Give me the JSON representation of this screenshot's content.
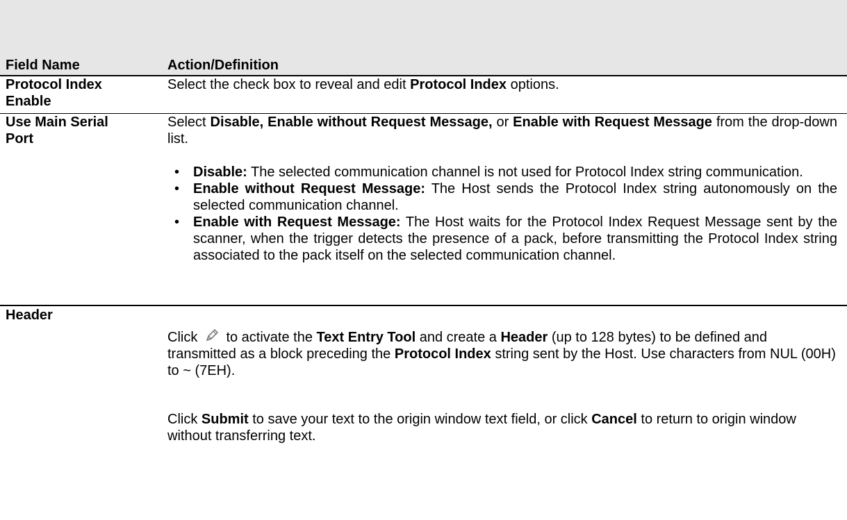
{
  "table": {
    "header": {
      "field": "Field Name",
      "action": "Action/Definition"
    },
    "rows": [
      {
        "field_line1": "Protocol Index",
        "field_line2": "Enable",
        "p1": [
          "Select the check box to reveal and edit ",
          "Protocol Index",
          " options."
        ]
      },
      {
        "field_line1": "Use Main Serial",
        "field_line2": "Port",
        "p1": [
          "Select ",
          "Disable, Enable without Request Message,",
          " or ",
          "Enable with Request Message",
          " from the drop-down list."
        ],
        "bullets": [
          {
            "term": "Disable:",
            "text": " The selected communication channel is not used for Protocol Index string communication."
          },
          {
            "term": "Enable without Request Message:",
            "text": " The Host sends the Protocol Index string autonomously on the selected communication channel."
          },
          {
            "term": "Enable with Request Message:",
            "text": " The Host waits for the Protocol Index Request Message sent by the scanner, when the trigger detects the presence of a pack, before transmitting the Protocol Index string associated to the pack itself on the selected communication channel."
          }
        ]
      },
      {
        "field_line1": "Header",
        "p1": [
          "Click ",
          " to activate the ",
          "Text Entry Tool",
          " and create a ",
          "Header",
          " (up to 128 bytes) to be defined and transmitted as a block preceding the ",
          "Protocol Index",
          " string sent by the Host. Use characters from NUL (00H) to ~ (7EH)."
        ],
        "p2": [
          "Click ",
          "Submit",
          " to save your text to the origin window text field, or click ",
          "Cancel",
          " to return to origin window without transferring text."
        ]
      }
    ]
  },
  "icons": {
    "edit": "pencil-icon"
  }
}
